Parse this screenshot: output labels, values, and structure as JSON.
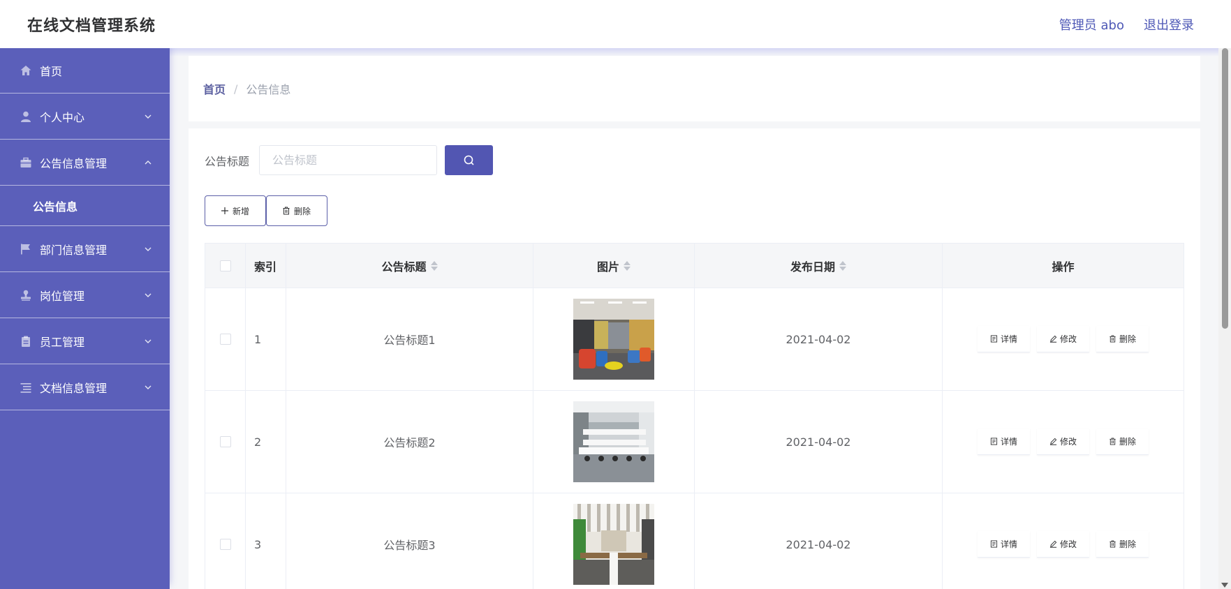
{
  "app": {
    "title": "在线文档管理系统"
  },
  "header": {
    "user_label": "管理员 abo",
    "logout_label": "退出登录"
  },
  "sidebar": {
    "items": [
      {
        "label": "首页",
        "icon": "home-icon",
        "expanded": null
      },
      {
        "label": "个人中心",
        "icon": "user-icon",
        "expanded": false
      },
      {
        "label": "公告信息管理",
        "icon": "briefcase-icon",
        "expanded": true
      },
      {
        "label": "部门信息管理",
        "icon": "flag-icon",
        "expanded": false
      },
      {
        "label": "岗位管理",
        "icon": "stamp-icon",
        "expanded": false
      },
      {
        "label": "员工管理",
        "icon": "clipboard-icon",
        "expanded": false
      },
      {
        "label": "文档信息管理",
        "icon": "list-icon",
        "expanded": false
      }
    ],
    "submenu": {
      "label": "公告信息"
    }
  },
  "breadcrumb": {
    "home": "首页",
    "separator": "/",
    "current": "公告信息"
  },
  "search": {
    "label": "公告标题",
    "placeholder": "公告标题",
    "value": ""
  },
  "actions": {
    "add_label": "新增",
    "delete_label": "删除"
  },
  "table": {
    "columns": {
      "index": "索引",
      "title": "公告标题",
      "image": "图片",
      "date": "发布日期",
      "ops": "操作"
    },
    "ops": {
      "detail": "详情",
      "edit": "修改",
      "delete": "删除"
    },
    "rows": [
      {
        "index": "1",
        "title": "公告标题1",
        "date": "2021-04-02"
      },
      {
        "index": "2",
        "title": "公告标题2",
        "date": "2021-04-02"
      },
      {
        "index": "3",
        "title": "公告标题3",
        "date": "2021-04-02"
      }
    ]
  },
  "colors": {
    "sidebar": "#5b5fba",
    "primary": "#5256b2",
    "header_text": "#4e58b6"
  }
}
